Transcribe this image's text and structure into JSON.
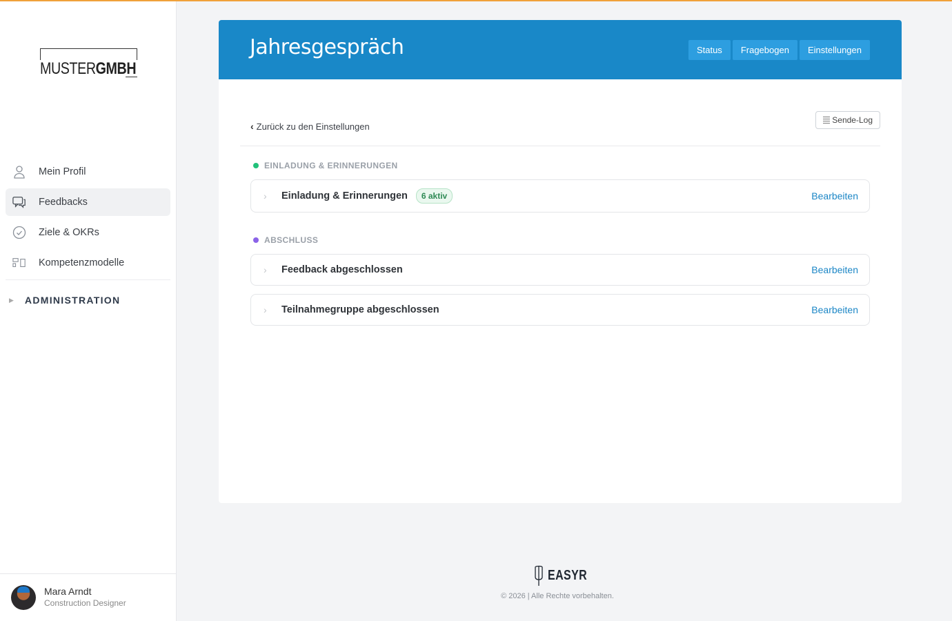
{
  "brand": {
    "logo_light": "MUSTER",
    "logo_bold": "GMBH"
  },
  "sidebar": {
    "items": [
      {
        "label": "Mein Profil",
        "icon": "user-icon",
        "active": false
      },
      {
        "label": "Feedbacks",
        "icon": "chat-icon",
        "active": true
      },
      {
        "label": "Ziele & OKRs",
        "icon": "check-circle-icon",
        "active": false
      },
      {
        "label": "Kompetenzmodelle",
        "icon": "blocks-icon",
        "active": false
      }
    ],
    "admin_label": "ADMINISTRATION"
  },
  "user": {
    "name": "Mara Arndt",
    "role": "Construction Designer"
  },
  "header": {
    "title": "Jahresgespräch",
    "tabs": [
      "Status",
      "Fragebogen",
      "Einstellungen"
    ]
  },
  "toolbar": {
    "back_label": "Zurück zu den Einstellungen",
    "sendelog_label": "Sende-Log"
  },
  "sections": [
    {
      "label": "EINLADUNG & ERINNERUNGEN",
      "dot_color": "#22c17a",
      "rows": [
        {
          "title": "Einladung & Erinnerungen",
          "badge": "6 aktiv",
          "action": "Bearbeiten"
        }
      ]
    },
    {
      "label": "ABSCHLUSS",
      "dot_color": "#8b63e8",
      "rows": [
        {
          "title": "Feedback abgeschlossen",
          "action": "Bearbeiten"
        },
        {
          "title": "Teilnahmegruppe abgeschlossen",
          "action": "Bearbeiten"
        }
      ]
    }
  ],
  "footer": {
    "logo_text": "EASYR",
    "copyright": "© 2026 | Alle Rechte vorbehalten."
  },
  "colors": {
    "primary": "#1988c8",
    "tab_bg": "#2d9ee0",
    "link": "#1b86c6",
    "accent_top": "#f0a13a"
  }
}
